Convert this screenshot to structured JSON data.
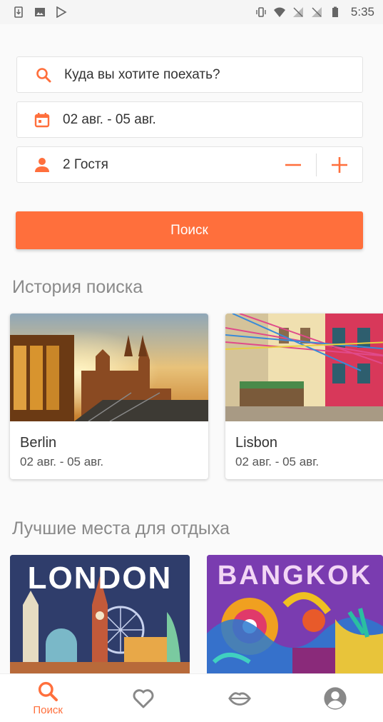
{
  "status_bar": {
    "time": "5:35"
  },
  "search": {
    "destination_placeholder": "Куда вы хотите поехать?",
    "dates": "02 авг. - 05 авг.",
    "guests": "2 Гостя",
    "button_label": "Поиск"
  },
  "history": {
    "title": "История поиска",
    "items": [
      {
        "city": "Berlin",
        "dates": "02 авг. - 05 авг."
      },
      {
        "city": "Lisbon",
        "dates": "02 авг. - 05 авг."
      }
    ]
  },
  "best": {
    "title": "Лучшие места для отдыха",
    "items": [
      {
        "title": "LONDON"
      },
      {
        "title": "BANGKOK"
      }
    ]
  },
  "nav": {
    "search_label": "Поиск"
  },
  "colors": {
    "accent": "#ff6f3c"
  },
  "icons": [
    "search-icon",
    "calendar-icon",
    "person-icon",
    "minus-icon",
    "plus-icon",
    "heart-icon",
    "lips-icon",
    "account-icon"
  ]
}
